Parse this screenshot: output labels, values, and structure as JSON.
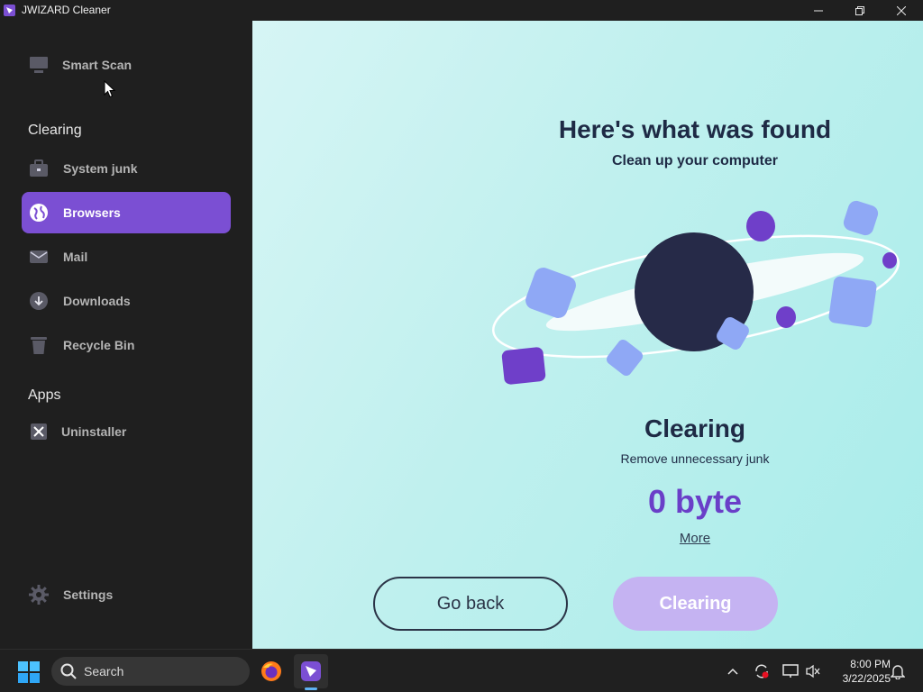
{
  "window": {
    "title": "JWIZARD Cleaner"
  },
  "sidebar": {
    "top_item": {
      "label": "Smart Scan",
      "icon": "monitor-icon"
    },
    "sections": [
      {
        "heading": "Clearing",
        "items": [
          {
            "label": "System junk",
            "icon": "briefcase-icon"
          },
          {
            "label": "Browsers",
            "icon": "globe-icon",
            "active": true
          },
          {
            "label": "Mail",
            "icon": "mail-icon"
          },
          {
            "label": "Downloads",
            "icon": "download-icon"
          },
          {
            "label": "Recycle Bin",
            "icon": "trash-icon"
          }
        ]
      },
      {
        "heading": "Apps",
        "items": [
          {
            "label": "Uninstaller",
            "icon": "uninstall-icon"
          }
        ]
      }
    ],
    "settings": {
      "label": "Settings",
      "icon": "gear-icon"
    }
  },
  "main": {
    "heading": "Here's what was found",
    "subheading": "Clean up your computer",
    "status_title": "Clearing",
    "status_desc": "Remove unnecessary junk",
    "size_value": "0 byte",
    "more_link": "More",
    "back_button": "Go back",
    "clear_button": "Clearing"
  },
  "taskbar": {
    "search_placeholder": "Search",
    "time": "8:00 PM",
    "date": "3/22/2025"
  },
  "colors": {
    "accent": "#7b4fd3",
    "sidebar_bg": "#1f1f1f",
    "main_bg": "#bff0ee",
    "planet": "#262a48",
    "shape_light": "#8fa8f5",
    "shape_dark": "#6f3fc9"
  }
}
